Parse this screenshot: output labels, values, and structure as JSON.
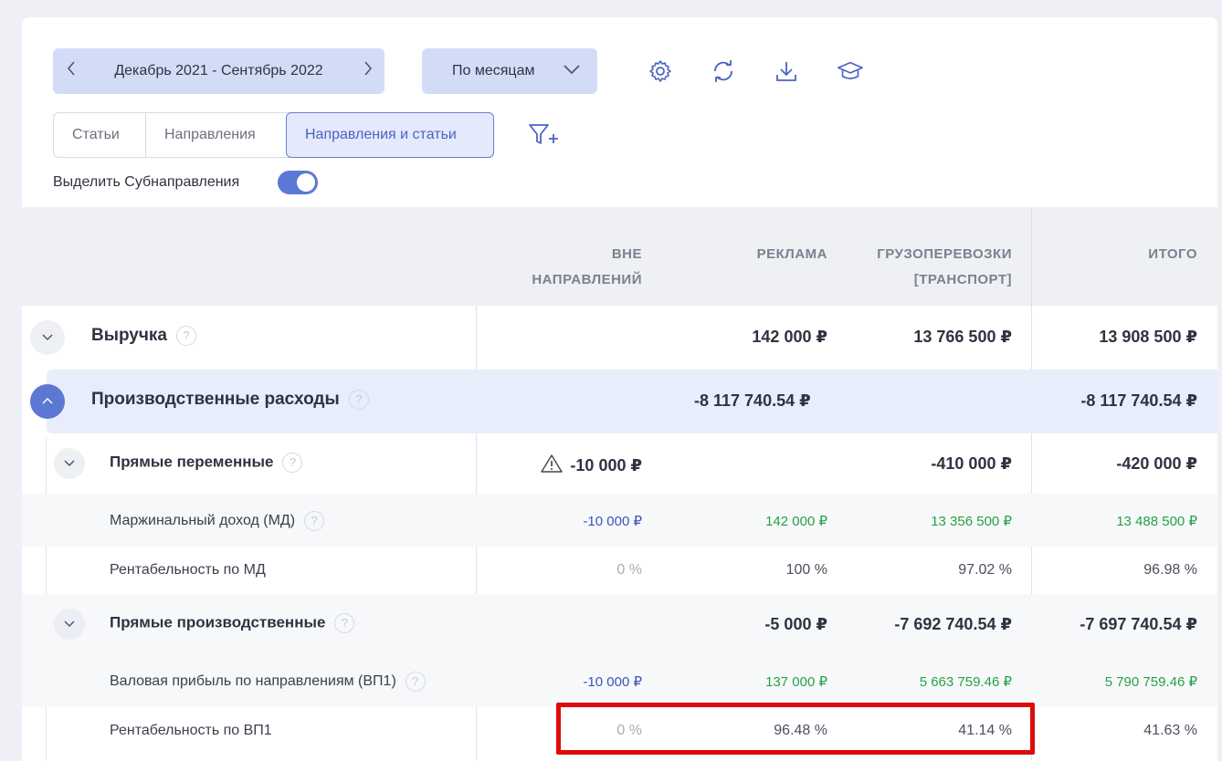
{
  "toolbar": {
    "period_label": "Декабрь 2021 - Сентябрь 2022",
    "grouping_label": "По месяцам",
    "icons": [
      "gear-icon",
      "refresh-icon",
      "download-icon",
      "graduation-cap-icon"
    ]
  },
  "tabs": [
    "Статьи",
    "Направления",
    "Направления и статьи"
  ],
  "active_tab": "Направления и статьи",
  "toggle": {
    "label": "Выделить Субнаправления",
    "on": true
  },
  "columns": {
    "c1": [
      "ВНЕ",
      "НАПРАВЛЕНИЙ"
    ],
    "c2": [
      "РЕКЛАМА"
    ],
    "c3": [
      "ГРУЗОПЕРЕВОЗКИ",
      "[ТРАНСПОРТ]"
    ],
    "c4": [
      "ИТОГО"
    ]
  },
  "rows": [
    {
      "label": "Выручка",
      "c1": "",
      "c2": "142 000 ₽",
      "c3": "13 766 500 ₽",
      "c4": "13 908 500 ₽"
    },
    {
      "label": "Производственные расходы",
      "merged": "-8 117 740.54 ₽",
      "c4": "-8 117 740.54 ₽"
    },
    {
      "label": "Прямые переменные",
      "c1": "-10 000 ₽",
      "c2": "",
      "c3": "-410 000 ₽",
      "c4": "-420 000 ₽"
    },
    {
      "label": "Маржинальный доход (МД)",
      "c1": "-10 000 ₽",
      "c2": "142 000 ₽",
      "c3": "13 356 500 ₽",
      "c4": "13 488 500 ₽"
    },
    {
      "label": "Рентабельность по МД",
      "c1": "0 %",
      "c2": "100 %",
      "c3": "97.02 %",
      "c4": "96.98 %"
    },
    {
      "label": "Прямые производственные",
      "c1": "",
      "c2": "-5 000 ₽",
      "c3": "-7 692 740.54 ₽",
      "c4": "-7 697 740.54 ₽"
    },
    {
      "label": "Валовая прибыль по направлениям (ВП1)",
      "c1": "-10 000 ₽",
      "c2": "137 000 ₽",
      "c3": "5 663 759.46 ₽",
      "c4": "5 790 759.46 ₽"
    },
    {
      "label": "Рентабельность по ВП1",
      "c1": "0 %",
      "c2": "96.48 %",
      "c3": "41.14 %",
      "c4": "41.63 %"
    }
  ],
  "help_glyph": "?",
  "colors": {
    "accent": "#5a78d4",
    "positive": "#27a145",
    "negative_blue": "#3a55b8",
    "highlight": "#dd0b0b"
  }
}
